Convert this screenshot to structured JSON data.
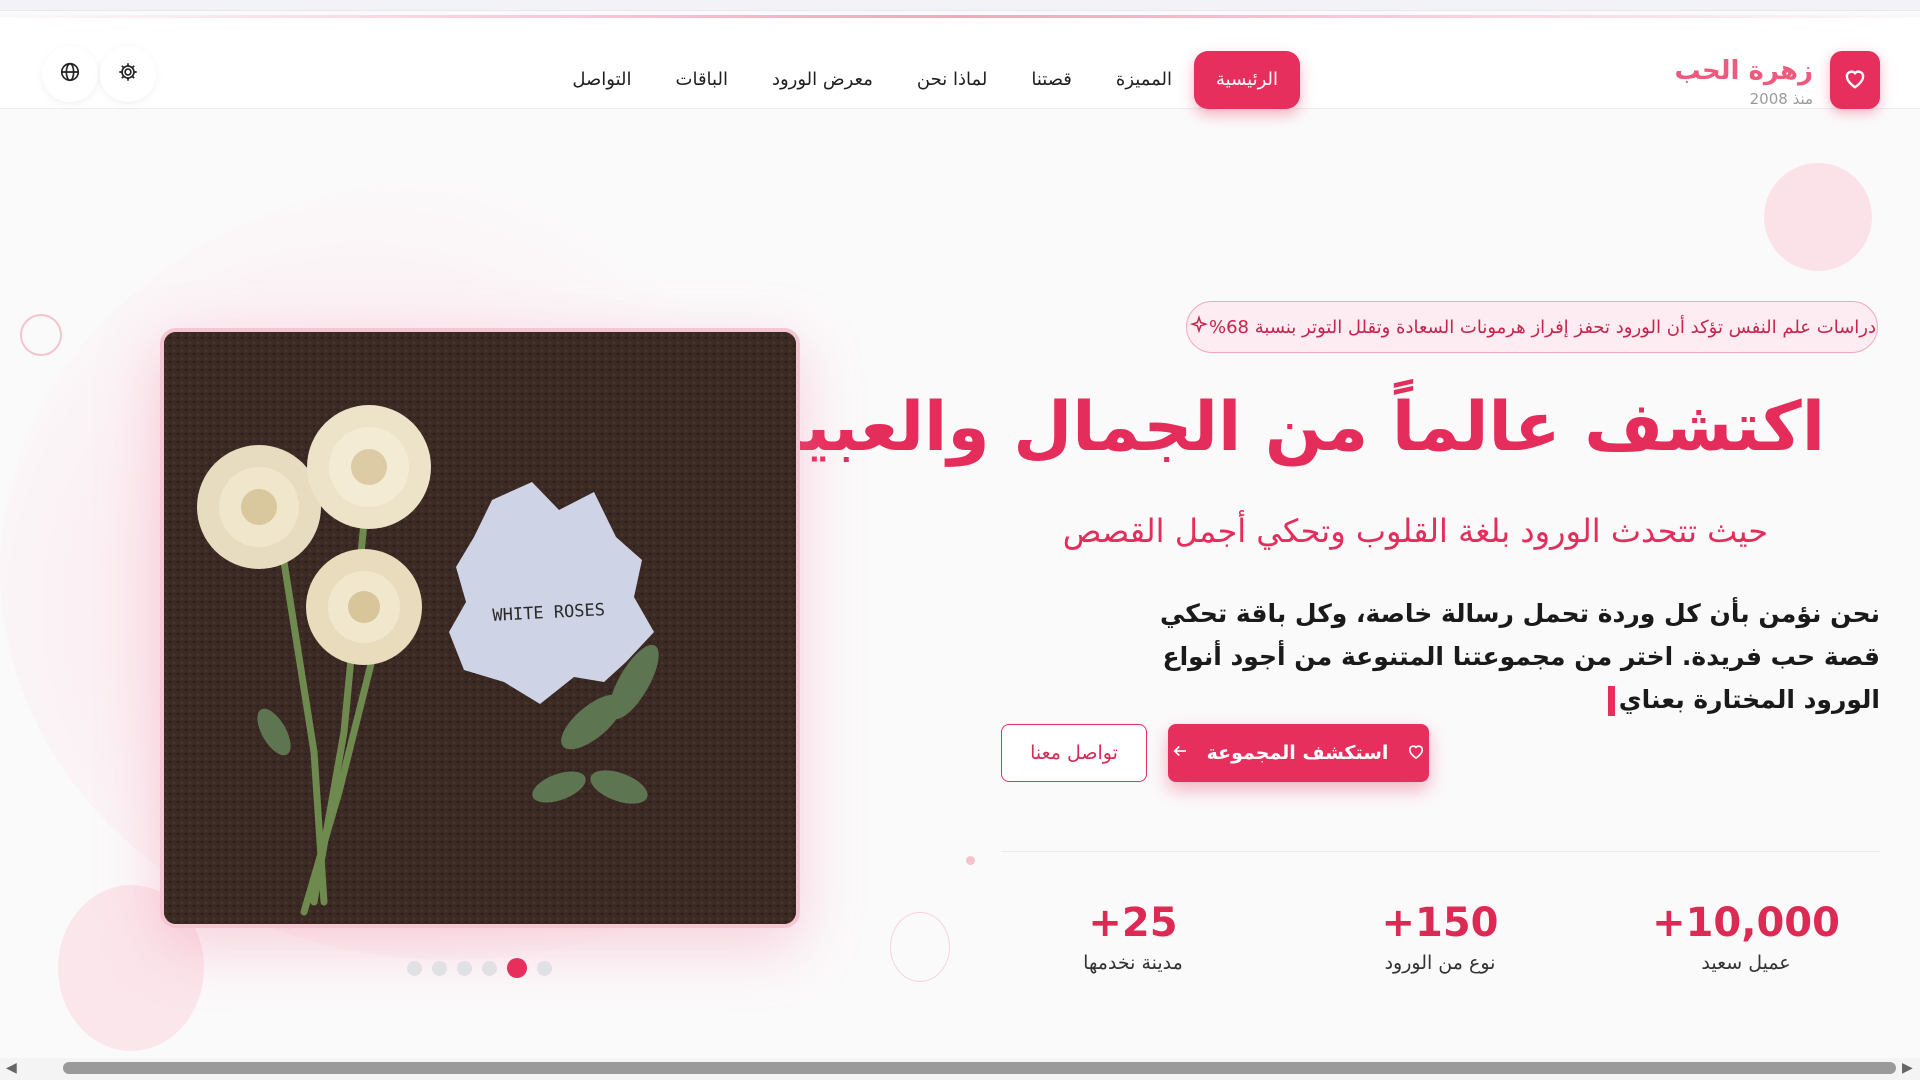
{
  "brand": {
    "name": "زهرة الحب",
    "since": "منذ 2008",
    "logo_icon": "heart-icon",
    "color": "#e62f5c"
  },
  "nav": {
    "items": [
      {
        "label": "الرئيسية",
        "active": true
      },
      {
        "label": "المميزة",
        "active": false
      },
      {
        "label": "قصتنا",
        "active": false
      },
      {
        "label": "لماذا نحن",
        "active": false
      },
      {
        "label": "معرض الورود",
        "active": false
      },
      {
        "label": "الباقات",
        "active": false
      },
      {
        "label": "التواصل",
        "active": false
      }
    ]
  },
  "header_buttons": {
    "settings_icon": "gear-icon",
    "language_icon": "globe-icon"
  },
  "hero": {
    "badge": "دراسات علم النفس تؤكد أن الورود تحفز إفراز هرمونات السعادة وتقلل التوتر بنسبة 68%",
    "badge_icon": "sparkle-icon",
    "title": "اكتشف عالماً من الجمال والعبير",
    "subtitle": "حيث تتحدث الورود بلغة القلوب وتحكي أجمل القصص",
    "description": "نحن نؤمن بأن كل وردة تحمل رسالة خاصة، وكل باقة تحكي قصة حب فريدة. اختر من مجموعتنا المتنوعة من أجود أنواع الورود المختارة بعناي",
    "primary_button": "استكشف المجموعة",
    "secondary_button": "تواصل معنا"
  },
  "stats": [
    {
      "value": "+10,000",
      "label": "عميل سعيد"
    },
    {
      "value": "+150",
      "label": "نوع من الورود"
    },
    {
      "value": "+25",
      "label": "مدينة نخدمها"
    }
  ],
  "slider": {
    "image_caption": "WHITE ROSES",
    "slide_count": 6,
    "active_index": 4
  }
}
